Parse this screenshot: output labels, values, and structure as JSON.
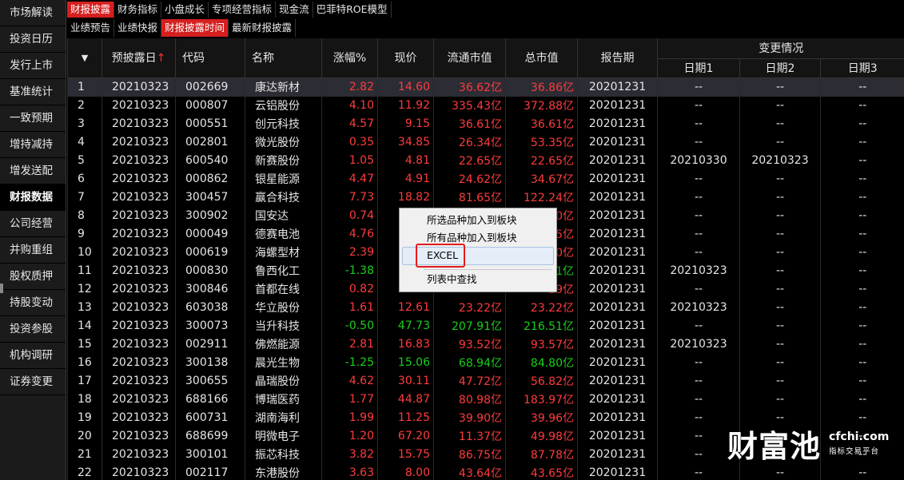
{
  "sidebar": {
    "items": [
      {
        "label": "市场解读",
        "active": false
      },
      {
        "label": "投资日历",
        "active": false
      },
      {
        "label": "发行上市",
        "active": false
      },
      {
        "label": "基准统计",
        "active": false
      },
      {
        "label": "一致预期",
        "active": false
      },
      {
        "label": "增持减持",
        "active": false
      },
      {
        "label": "增发送配",
        "active": false
      },
      {
        "label": "财报数据",
        "active": true
      },
      {
        "label": "公司经营",
        "active": false
      },
      {
        "label": "并购重组",
        "active": false
      },
      {
        "label": "股权质押",
        "active": false
      },
      {
        "label": "持股变动",
        "active": false
      },
      {
        "label": "投资参股",
        "active": false
      },
      {
        "label": "机构调研",
        "active": false
      },
      {
        "label": "证券变更",
        "active": false
      }
    ]
  },
  "tabs_top": [
    {
      "label": "财报披露",
      "active": true
    },
    {
      "label": "财务指标",
      "active": false
    },
    {
      "label": "小盘成长",
      "active": false
    },
    {
      "label": "专项经营指标",
      "active": false
    },
    {
      "label": "现金流",
      "active": false
    },
    {
      "label": "巴菲特ROE模型",
      "active": false
    }
  ],
  "tabs_sub": [
    {
      "label": "业绩预告",
      "active": false
    },
    {
      "label": "业绩快报",
      "active": false
    },
    {
      "label": "财报披露时间",
      "active": true
    },
    {
      "label": "最新财报披露",
      "active": false
    }
  ],
  "table": {
    "menu_arrow": "▼",
    "headers": {
      "date": "预披露日",
      "sort_indicator": "↑",
      "code": "代码",
      "name": "名称",
      "change": "涨幅%",
      "price": "现价",
      "float_cap": "流通市值",
      "total_cap": "总市值",
      "period": "报告期",
      "change_group": "变更情况",
      "d1": "日期1",
      "d2": "日期2",
      "d3": "日期3"
    },
    "rows": [
      {
        "idx": "1",
        "date": "20210323",
        "code": "002669",
        "name": "康达新材",
        "chg": "2.82",
        "price": "14.60",
        "fcap": "36.62亿",
        "tcap": "36.86亿",
        "period": "20201231",
        "d1": "--",
        "d2": "--",
        "d3": "--",
        "dir": "up"
      },
      {
        "idx": "2",
        "date": "20210323",
        "code": "000807",
        "name": "云铝股份",
        "chg": "4.10",
        "price": "11.92",
        "fcap": "335.43亿",
        "tcap": "372.88亿",
        "period": "20201231",
        "d1": "--",
        "d2": "--",
        "d3": "--",
        "dir": "up"
      },
      {
        "idx": "3",
        "date": "20210323",
        "code": "000551",
        "name": "创元科技",
        "chg": "4.57",
        "price": "9.15",
        "fcap": "36.61亿",
        "tcap": "36.61亿",
        "period": "20201231",
        "d1": "--",
        "d2": "--",
        "d3": "--",
        "dir": "up"
      },
      {
        "idx": "4",
        "date": "20210323",
        "code": "002801",
        "name": "微光股份",
        "chg": "0.35",
        "price": "34.85",
        "fcap": "26.34亿",
        "tcap": "53.35亿",
        "period": "20201231",
        "d1": "--",
        "d2": "--",
        "d3": "--",
        "dir": "up"
      },
      {
        "idx": "5",
        "date": "20210323",
        "code": "600540",
        "name": "新赛股份",
        "chg": "1.05",
        "price": "4.81",
        "fcap": "22.65亿",
        "tcap": "22.65亿",
        "period": "20201231",
        "d1": "20210330",
        "d2": "20210323",
        "d3": "--",
        "dir": "up"
      },
      {
        "idx": "6",
        "date": "20210323",
        "code": "000862",
        "name": "银星能源",
        "chg": "4.47",
        "price": "4.91",
        "fcap": "24.62亿",
        "tcap": "34.67亿",
        "period": "20201231",
        "d1": "--",
        "d2": "--",
        "d3": "--",
        "dir": "up"
      },
      {
        "idx": "7",
        "date": "20210323",
        "code": "300457",
        "name": "赢合科技",
        "chg": "7.73",
        "price": "18.82",
        "fcap": "81.65亿",
        "tcap": "122.24亿",
        "period": "20201231",
        "d1": "--",
        "d2": "--",
        "d3": "--",
        "dir": "up"
      },
      {
        "idx": "8",
        "date": "20210323",
        "code": "300902",
        "name": "国安达",
        "chg": "0.74",
        "price": "",
        "fcap": "",
        "tcap": "50亿",
        "period": "20201231",
        "d1": "--",
        "d2": "--",
        "d3": "--",
        "dir": "up"
      },
      {
        "idx": "9",
        "date": "20210323",
        "code": "000049",
        "name": "德赛电池",
        "chg": "4.76",
        "price": "",
        "fcap": "",
        "tcap": "45亿",
        "period": "20201231",
        "d1": "--",
        "d2": "--",
        "d3": "--",
        "dir": "up"
      },
      {
        "idx": "10",
        "date": "20210323",
        "code": "000619",
        "name": "海螺型材",
        "chg": "2.39",
        "price": "",
        "fcap": "",
        "tcap": "50亿",
        "period": "20201231",
        "d1": "--",
        "d2": "--",
        "d3": "--",
        "dir": "up"
      },
      {
        "idx": "11",
        "date": "20210323",
        "code": "000830",
        "name": "鲁西化工",
        "chg": "-1.38",
        "price": "",
        "fcap": "",
        "tcap": "41亿",
        "period": "20201231",
        "d1": "20210323",
        "d2": "--",
        "d3": "--",
        "dir": "down"
      },
      {
        "idx": "12",
        "date": "20210323",
        "code": "300846",
        "name": "首都在线",
        "chg": "0.82",
        "price": "",
        "fcap": "",
        "tcap": "29亿",
        "period": "20201231",
        "d1": "--",
        "d2": "--",
        "d3": "--",
        "dir": "up"
      },
      {
        "idx": "13",
        "date": "20210323",
        "code": "603038",
        "name": "华立股份",
        "chg": "1.61",
        "price": "12.61",
        "fcap": "23.22亿",
        "tcap": "23.22亿",
        "period": "20201231",
        "d1": "20210323",
        "d2": "--",
        "d3": "--",
        "dir": "up"
      },
      {
        "idx": "14",
        "date": "20210323",
        "code": "300073",
        "name": "当升科技",
        "chg": "-0.50",
        "price": "47.73",
        "fcap": "207.91亿",
        "tcap": "216.51亿",
        "period": "20201231",
        "d1": "--",
        "d2": "--",
        "d3": "--",
        "dir": "down"
      },
      {
        "idx": "15",
        "date": "20210323",
        "code": "002911",
        "name": "佛燃能源",
        "chg": "2.81",
        "price": "16.83",
        "fcap": "93.52亿",
        "tcap": "93.57亿",
        "period": "20201231",
        "d1": "20210323",
        "d2": "--",
        "d3": "--",
        "dir": "up"
      },
      {
        "idx": "16",
        "date": "20210323",
        "code": "300138",
        "name": "晨光生物",
        "chg": "-1.25",
        "price": "15.06",
        "fcap": "68.94亿",
        "tcap": "84.80亿",
        "period": "20201231",
        "d1": "--",
        "d2": "--",
        "d3": "--",
        "dir": "down"
      },
      {
        "idx": "17",
        "date": "20210323",
        "code": "300655",
        "name": "晶瑞股份",
        "chg": "4.62",
        "price": "30.11",
        "fcap": "47.72亿",
        "tcap": "56.82亿",
        "period": "20201231",
        "d1": "--",
        "d2": "--",
        "d3": "--",
        "dir": "up"
      },
      {
        "idx": "18",
        "date": "20210323",
        "code": "688166",
        "name": "博瑞医药",
        "chg": "1.77",
        "price": "44.87",
        "fcap": "80.98亿",
        "tcap": "183.97亿",
        "period": "20201231",
        "d1": "--",
        "d2": "--",
        "d3": "--",
        "dir": "up"
      },
      {
        "idx": "19",
        "date": "20210323",
        "code": "600731",
        "name": "湖南海利",
        "chg": "1.99",
        "price": "11.25",
        "fcap": "39.90亿",
        "tcap": "39.96亿",
        "period": "20201231",
        "d1": "--",
        "d2": "--",
        "d3": "--",
        "dir": "up"
      },
      {
        "idx": "20",
        "date": "20210323",
        "code": "688699",
        "name": "明微电子",
        "chg": "1.20",
        "price": "67.20",
        "fcap": "11.37亿",
        "tcap": "49.98亿",
        "period": "20201231",
        "d1": "--",
        "d2": "--",
        "d3": "--",
        "dir": "up"
      },
      {
        "idx": "21",
        "date": "20210323",
        "code": "300101",
        "name": "振芯科技",
        "chg": "3.82",
        "price": "15.75",
        "fcap": "86.75亿",
        "tcap": "87.78亿",
        "period": "20201231",
        "d1": "--",
        "d2": "--",
        "d3": "--",
        "dir": "up"
      },
      {
        "idx": "22",
        "date": "20210323",
        "code": "002117",
        "name": "东港股份",
        "chg": "3.63",
        "price": "8.00",
        "fcap": "43.64亿",
        "tcap": "43.65亿",
        "period": "20201231",
        "d1": "--",
        "d2": "--",
        "d3": "--",
        "dir": "up"
      }
    ]
  },
  "context_menu": {
    "items": [
      "所选品种加入到板块",
      "所有品种加入到板块",
      "EXCEL",
      "列表中查找"
    ]
  },
  "watermark": {
    "logo": "财富池",
    "domain": "cfchi.com",
    "tagline": "指标交易平台"
  },
  "colors": {
    "up": "#ff3b3b",
    "down": "#19d019",
    "accent": "#d61f1f"
  }
}
